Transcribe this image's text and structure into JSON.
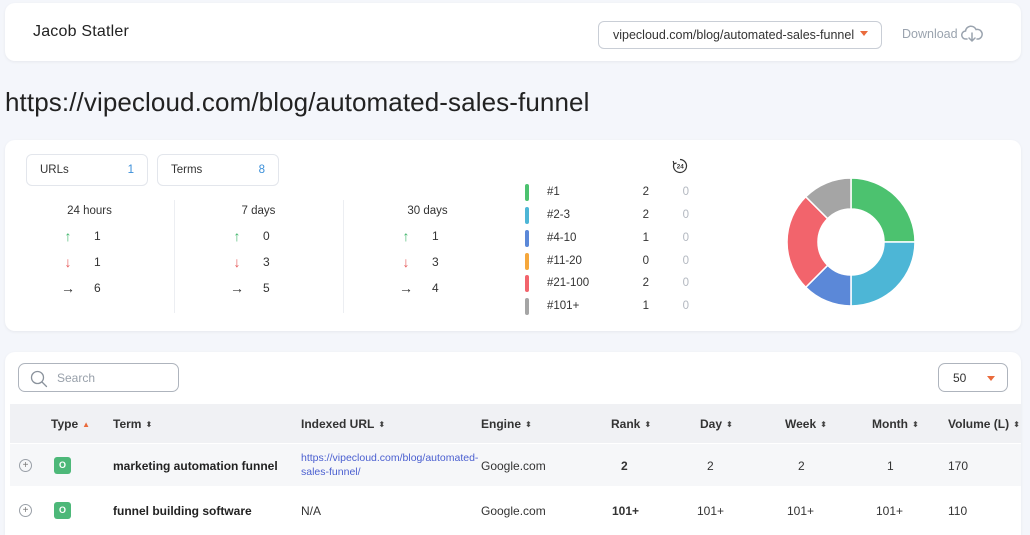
{
  "header": {
    "user_name": "Jacob Statler",
    "url_select": "vipecloud.com/blog/automated-sales-funnel",
    "download_label": "Download"
  },
  "page_title": "https://vipecloud.com/blog/automated-sales-funnel",
  "summary": {
    "urls_label": "URLs",
    "urls_value": "1",
    "terms_label": "Terms",
    "terms_value": "8"
  },
  "periods": [
    {
      "title": "24 hours",
      "up": "1",
      "down": "1",
      "flat": "6"
    },
    {
      "title": "7 days",
      "up": "0",
      "down": "3",
      "flat": "5"
    },
    {
      "title": "30 days",
      "up": "1",
      "down": "3",
      "flat": "4"
    }
  ],
  "timer_label": "24",
  "rank_distribution": [
    {
      "label": "#1",
      "count": "2",
      "change": "0",
      "color": "#4cc26f"
    },
    {
      "label": "#2-3",
      "count": "2",
      "change": "0",
      "color": "#4db6d6"
    },
    {
      "label": "#4-10",
      "count": "1",
      "change": "0",
      "color": "#5b88d8"
    },
    {
      "label": "#11-20",
      "count": "0",
      "change": "0",
      "color": "#f5a73c"
    },
    {
      "label": "#21-100",
      "count": "2",
      "change": "0",
      "color": "#f2646c"
    },
    {
      "label": "#101+",
      "count": "1",
      "change": "0",
      "color": "#a5a5a5"
    }
  ],
  "chart_data": {
    "type": "pie",
    "categories": [
      "#1",
      "#2-3",
      "#4-10",
      "#11-20",
      "#21-100",
      "#101+"
    ],
    "values": [
      2,
      2,
      1,
      0,
      2,
      1
    ],
    "colors": [
      "#4cc26f",
      "#4db6d6",
      "#5b88d8",
      "#f5a73c",
      "#f2646c",
      "#a5a5a5"
    ],
    "title": "",
    "donut": true
  },
  "table": {
    "search_placeholder": "Search",
    "per_page": "50",
    "columns": [
      "Type",
      "Term",
      "Indexed URL",
      "Engine",
      "Rank",
      "Day",
      "Week",
      "Month",
      "Volume (L)"
    ],
    "rows": [
      {
        "type": "O",
        "term": "marketing automation funnel",
        "url": "https://vipecloud.com/blog/automated-sales-funnel/",
        "engine": "Google.com",
        "rank": "2",
        "day": "2",
        "week": "2",
        "month": "1",
        "volume": "170"
      },
      {
        "type": "O",
        "term": "funnel building software",
        "url": "N/A",
        "engine": "Google.com",
        "rank": "101+",
        "day": "101+",
        "week": "101+",
        "month": "101+",
        "volume": "110"
      }
    ]
  }
}
